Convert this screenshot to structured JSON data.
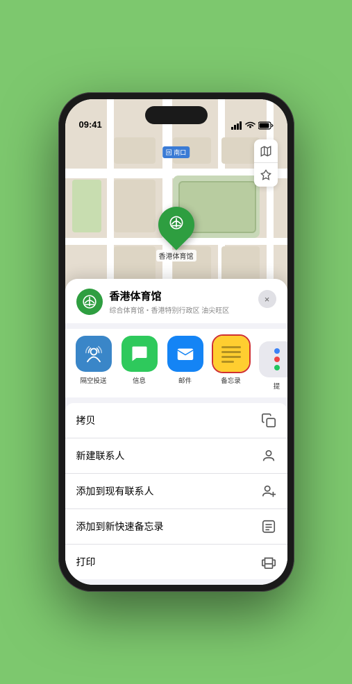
{
  "status": {
    "time": "09:41",
    "location_arrow": "▲",
    "signal": "●●●●",
    "wifi": "WiFi",
    "battery": "Battery"
  },
  "map": {
    "south_label": "南口",
    "south_label_prefix": "回",
    "venue_name_on_map": "香港体育馆",
    "controls": {
      "map_icon": "🗺",
      "location_icon": "⊳"
    }
  },
  "venue_card": {
    "icon": "🏟",
    "name": "香港体育馆",
    "description": "综合体育馆・香港特别行政区 油尖旺区",
    "close_label": "×"
  },
  "share_items": [
    {
      "id": "airdrop",
      "label": "隔空投送",
      "type": "airdrop"
    },
    {
      "id": "message",
      "label": "信息",
      "type": "message"
    },
    {
      "id": "mail",
      "label": "邮件",
      "type": "mail"
    },
    {
      "id": "notes",
      "label": "备忘录",
      "type": "notes",
      "selected": true
    },
    {
      "id": "more",
      "label": "提",
      "type": "more"
    }
  ],
  "more_dots": [
    {
      "color": "#3b82f6"
    },
    {
      "color": "#ef4444"
    },
    {
      "color": "#22c55e"
    }
  ],
  "actions": [
    {
      "id": "copy",
      "label": "拷贝",
      "icon": "copy"
    },
    {
      "id": "new-contact",
      "label": "新建联系人",
      "icon": "person"
    },
    {
      "id": "add-existing",
      "label": "添加到现有联系人",
      "icon": "person-add"
    },
    {
      "id": "add-note",
      "label": "添加到新快速备忘录",
      "icon": "note"
    },
    {
      "id": "print",
      "label": "打印",
      "icon": "print"
    }
  ]
}
